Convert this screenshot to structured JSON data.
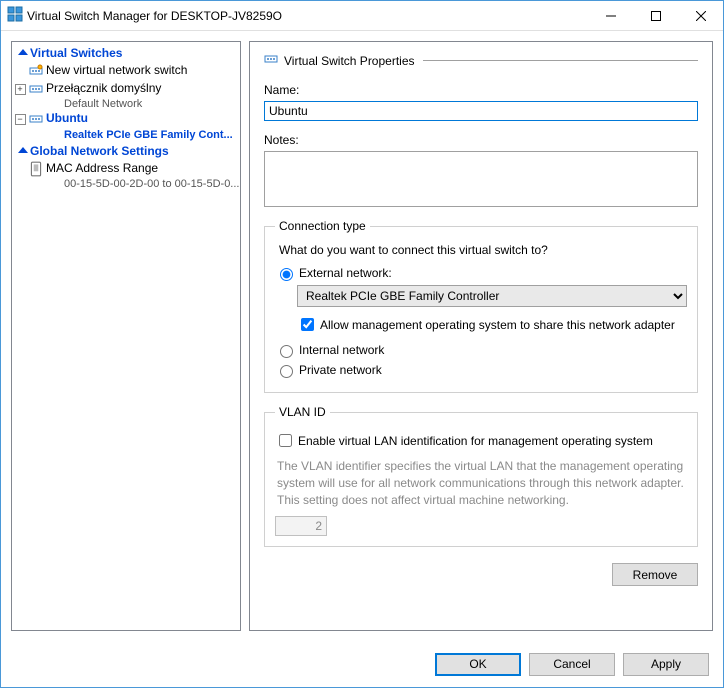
{
  "window": {
    "title": "Virtual Switch Manager for DESKTOP-JV8259O"
  },
  "sidebar": {
    "groups": [
      {
        "label": "Virtual Switches",
        "items": [
          {
            "label": "New virtual network switch",
            "sub": ""
          },
          {
            "label": "Przełącznik domyślny",
            "sub": "Default Network"
          },
          {
            "label": "Ubuntu",
            "sub": "Realtek PCIe GBE Family Cont...",
            "selected": true
          }
        ]
      },
      {
        "label": "Global Network Settings",
        "items": [
          {
            "label": "MAC Address Range",
            "sub": "00-15-5D-00-2D-00 to 00-15-5D-0..."
          }
        ]
      }
    ]
  },
  "panel": {
    "heading": "Virtual Switch Properties",
    "name_label": "Name:",
    "name_value": "Ubuntu",
    "notes_label": "Notes:",
    "notes_value": "",
    "conn": {
      "legend": "Connection type",
      "hint": "What do you want to connect this virtual switch to?",
      "external_label": "External network:",
      "adapter_selected": "Realtek PCIe GBE Family Controller",
      "allow_mgmt_label": "Allow management operating system to share this network adapter",
      "internal_label": "Internal network",
      "private_label": "Private network"
    },
    "vlan": {
      "legend": "VLAN ID",
      "enable_label": "Enable virtual LAN identification for management operating system",
      "desc": "The VLAN identifier specifies the virtual LAN that the management operating system will use for all network communications through this network adapter. This setting does not affect virtual machine networking.",
      "value": "2"
    },
    "remove_label": "Remove"
  },
  "footer": {
    "ok": "OK",
    "cancel": "Cancel",
    "apply": "Apply"
  }
}
